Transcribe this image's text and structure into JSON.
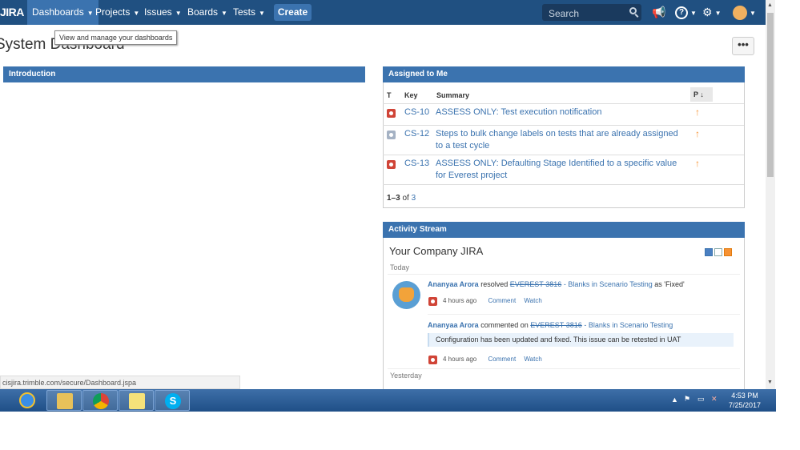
{
  "header": {
    "logo": "JIRA",
    "nav": [
      {
        "label": "Dashboards"
      },
      {
        "label": "Projects"
      },
      {
        "label": "Issues"
      },
      {
        "label": "Boards"
      },
      {
        "label": "Tests"
      }
    ],
    "create_label": "Create",
    "search_placeholder": "Search"
  },
  "tooltip": "View and manage your dashboards",
  "page": {
    "title": "System Dashboard",
    "more_label": "•••"
  },
  "gadgets": {
    "introduction": {
      "title": "Introduction"
    },
    "assigned": {
      "title": "Assigned to Me",
      "columns": {
        "type": "T",
        "key": "Key",
        "summary": "Summary",
        "priority": "P"
      },
      "rows": [
        {
          "type": "bug",
          "key": "CS-10",
          "summary": "ASSESS ONLY: Test execution notification"
        },
        {
          "type": "task",
          "key": "CS-12",
          "summary": "Steps to bulk change labels on tests that are already assigned to a test cycle"
        },
        {
          "type": "bug",
          "key": "CS-13",
          "summary": "ASSESS ONLY: Defaulting Stage Identified to a specific value for Everest project"
        }
      ],
      "pager": {
        "range": "1–3",
        "of": "of",
        "total": "3"
      }
    },
    "activity": {
      "title": "Activity Stream",
      "heading": "Your Company JIRA",
      "today_label": "Today",
      "yesterday_label": "Yesterday",
      "entries": [
        {
          "user": "Ananyaa Arora",
          "verb": "resolved",
          "issue_key": "EVEREST-3816",
          "issue_title": "- Blanks in Scenario Testing",
          "suffix": "as 'Fixed'",
          "time": "4 hours ago",
          "comment": "Comment",
          "watch": "Watch"
        },
        {
          "user": "Ananyaa Arora",
          "verb": "commented on",
          "issue_key": "EVEREST-3816",
          "issue_title": "- Blanks in Scenario Testing",
          "body": "Configuration has been updated and fixed. This issue can be retested in UAT",
          "time": "4 hours ago",
          "comment": "Comment",
          "watch": "Watch"
        }
      ]
    }
  },
  "statusbar": "cisjira.trimble.com/secure/Dashboard.jspa",
  "taskbar": {
    "time": "4:53 PM",
    "date": "7/25/2017"
  },
  "colors": {
    "header": "#205081",
    "gadget_header": "#3b73af",
    "link": "#3b73af",
    "priority": "#f79232",
    "bug": "#d04437"
  }
}
